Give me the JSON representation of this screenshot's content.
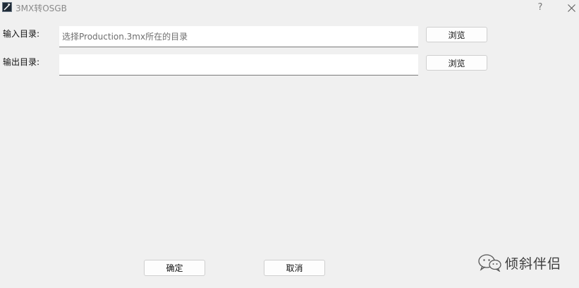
{
  "window": {
    "title": "3MX转OSGB",
    "help_glyph": "?",
    "app_icon": "app-icon",
    "close_icon": "close-icon"
  },
  "form": {
    "input_dir": {
      "label": "输入目录:",
      "value": "",
      "placeholder": "选择Production.3mx所在的目录",
      "browse_label": "浏览"
    },
    "output_dir": {
      "label": "输出目录:",
      "value": "",
      "placeholder": "",
      "browse_label": "浏览"
    }
  },
  "footer": {
    "ok_label": "确定",
    "cancel_label": "取消"
  },
  "watermark": {
    "text": "倾斜伴侣",
    "icon": "wechat-icon"
  }
}
